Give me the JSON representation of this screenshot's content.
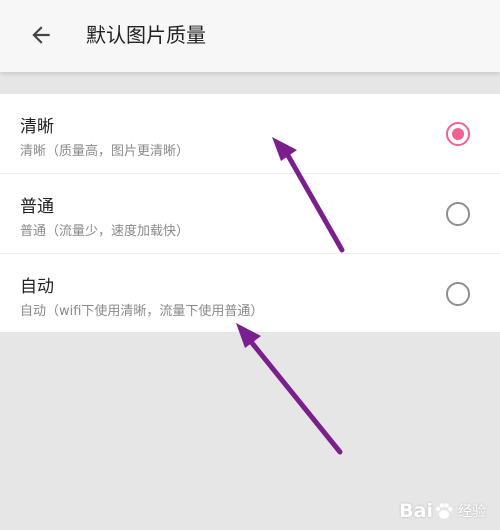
{
  "header": {
    "title": "默认图片质量",
    "back_icon": "arrow-left-icon"
  },
  "options": [
    {
      "title": "清晰",
      "subtitle": "清晰（质量高，图片更清晰）",
      "selected": true
    },
    {
      "title": "普通",
      "subtitle": "普通（流量少，速度加载快）",
      "selected": false
    },
    {
      "title": "自动",
      "subtitle": "自动（wifi下使用清晰，流量下使用普通）",
      "selected": false
    }
  ],
  "colors": {
    "accent": "#f06292",
    "arrow": "#7b1f8f",
    "background": "#e6e6e6"
  },
  "watermark": {
    "brand": "Bai",
    "suffix": "经验"
  }
}
